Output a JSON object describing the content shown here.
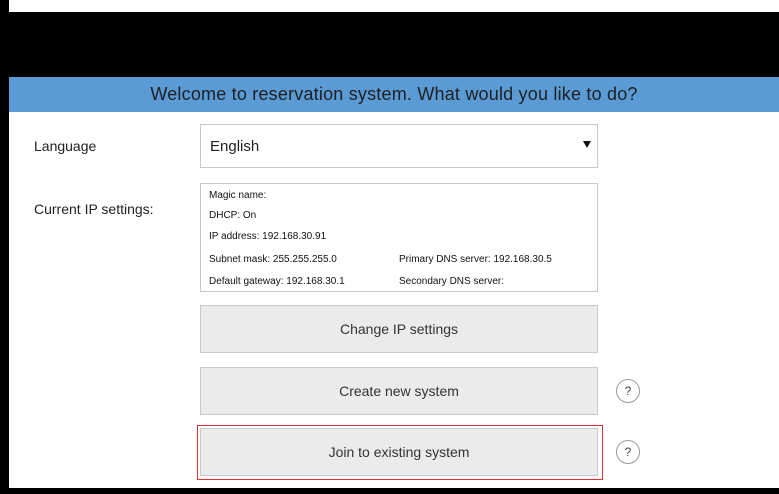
{
  "banner": {
    "title": "Welcome to reservation system. What would you like to do?"
  },
  "language": {
    "label": "Language",
    "selected": "English"
  },
  "ip_settings": {
    "label": "Current IP settings:",
    "magic_name": "Magic name:",
    "dhcp": "DHCP: On",
    "ip_address": "IP address: 192.168.30.91",
    "subnet_mask": "Subnet mask: 255.255.255.0",
    "primary_dns": "Primary DNS server: 192.168.30.5",
    "default_gateway": "Default gateway: 192.168.30.1",
    "secondary_dns": "Secondary DNS server:"
  },
  "buttons": {
    "change_ip": "Change IP settings",
    "create_new": "Create new system",
    "join_existing": "Join to existing system"
  },
  "help": {
    "glyph": "?"
  },
  "colors": {
    "banner": "#5b9bd5",
    "button_bg": "#ebebeb",
    "highlight": "#e03030"
  }
}
